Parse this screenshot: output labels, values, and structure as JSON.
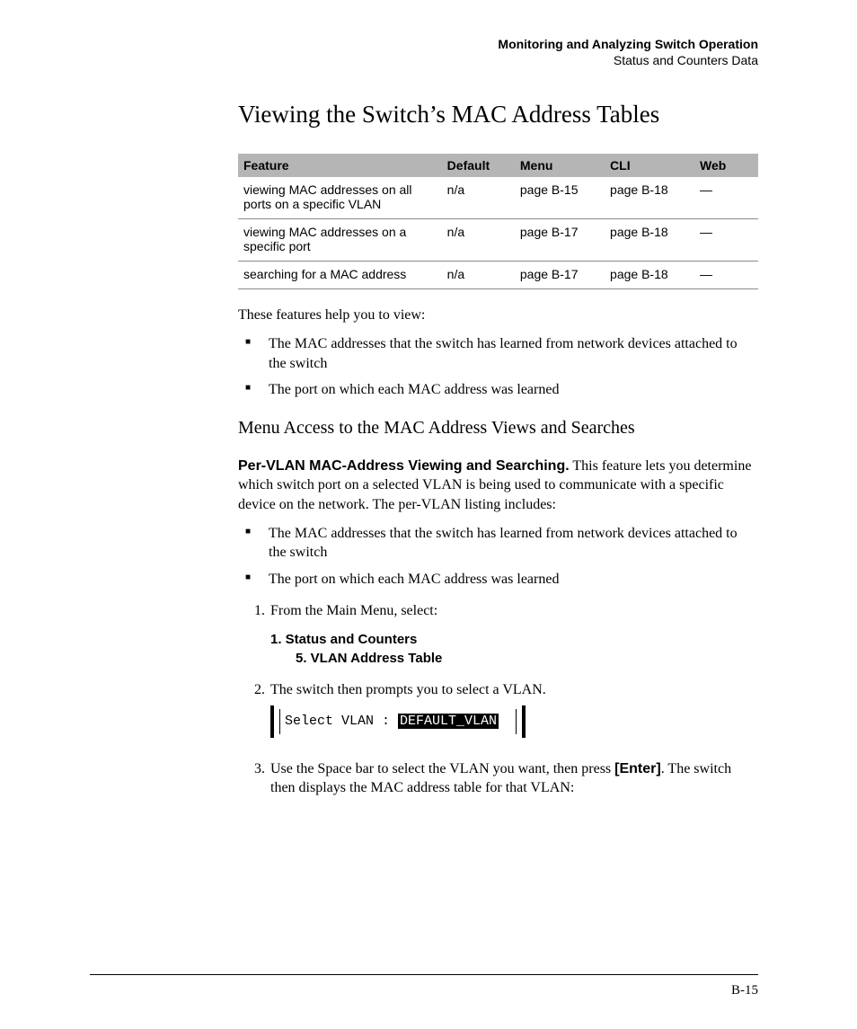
{
  "header": {
    "chapter": "Monitoring and Analyzing Switch Operation",
    "section": "Status and Counters Data"
  },
  "title": "Viewing the Switch’s MAC Address Tables",
  "table": {
    "headers": {
      "feature": "Feature",
      "default": "Default",
      "menu": "Menu",
      "cli": "CLI",
      "web": "Web"
    },
    "rows": [
      {
        "feature": "viewing MAC addresses on all ports on a specific VLAN",
        "default": "n/a",
        "menu": "page B-15",
        "cli": "page B-18",
        "web": "—"
      },
      {
        "feature": "viewing MAC addresses on a specific port",
        "default": "n/a",
        "menu": "page B-17",
        "cli": "page B-18",
        "web": "—"
      },
      {
        "feature": "searching for a MAC address",
        "default": "n/a",
        "menu": "page B-17",
        "cli": "page B-18",
        "web": "—"
      }
    ]
  },
  "intro": "These features help you to view:",
  "intro_bullets": [
    "The MAC addresses that the switch has learned from network devices attached to the switch",
    "The port on which each MAC address was learned"
  ],
  "subhead": "Menu Access to the MAC Address Views and Searches",
  "para_lead_runin": "Per-VLAN MAC-Address Viewing and Searching.",
  "para_lead_rest": "  This feature lets you determine which switch port on a selected VLAN is being used to communicate with a specific device on the network. The per-VLAN listing includes:",
  "para_bullets": [
    "The MAC addresses that the switch has learned from network devices attached to the switch",
    "The port on which each MAC address was learned"
  ],
  "steps": {
    "s1": "From the Main Menu, select:",
    "menu1": "1. Status and Counters",
    "menu2": "5. VLAN Address Table",
    "s2": "The switch then prompts you to select a VLAN.",
    "cli_label": "Select VLAN : ",
    "cli_value": "DEFAULT_VLAN ",
    "s3a": "Use the Space bar to select the VLAN you want, then press ",
    "s3key": "[Enter]",
    "s3b": ". The switch then displays the MAC address table for that VLAN:"
  },
  "page_number": "B-15",
  "chart_data": {
    "type": "table",
    "title": "Viewing the Switch’s MAC Address Tables — feature access reference",
    "columns": [
      "Feature",
      "Default",
      "Menu",
      "CLI",
      "Web"
    ],
    "rows": [
      [
        "viewing MAC addresses on all ports on a specific VLAN",
        "n/a",
        "page B-15",
        "page B-18",
        "—"
      ],
      [
        "viewing MAC addresses on a specific port",
        "n/a",
        "page B-17",
        "page B-18",
        "—"
      ],
      [
        "searching for a MAC address",
        "n/a",
        "page B-17",
        "page B-18",
        "—"
      ]
    ]
  }
}
